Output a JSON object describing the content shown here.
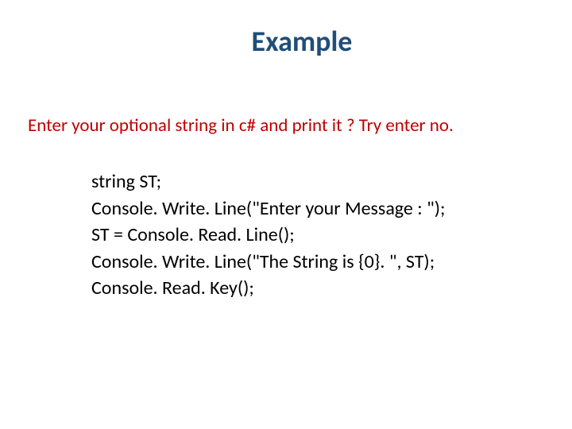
{
  "title": "Example",
  "subtitle": "Enter your optional string in c# and  print it  ?    Try enter no.",
  "code": {
    "line1": "string ST;",
    "line2": "Console. Write. Line(\"Enter your Message : \");",
    "line3": "ST = Console. Read. Line();",
    "line4": "Console. Write. Line(\"The String is {0}. \", ST);",
    "line5": "Console. Read. Key();"
  }
}
